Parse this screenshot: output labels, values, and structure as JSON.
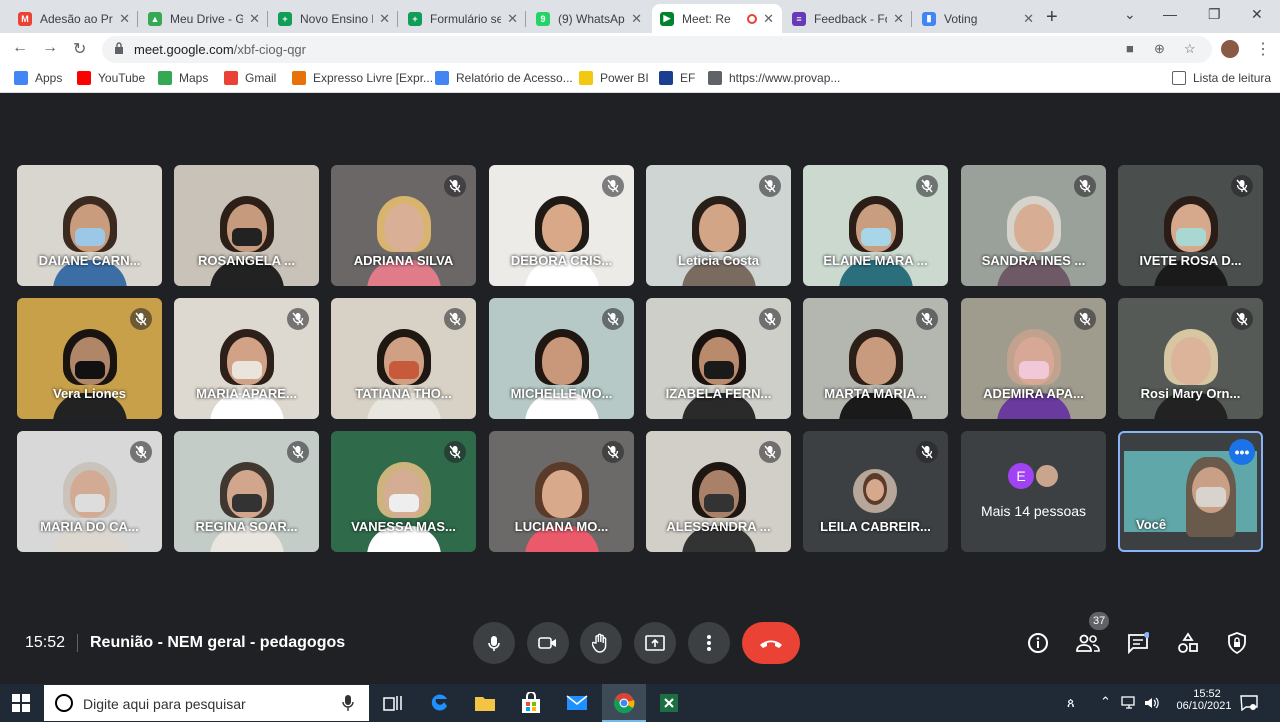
{
  "browser": {
    "tabs": [
      {
        "title": "Adesão ao Pr",
        "color": "#ea4335",
        "glyph": "M"
      },
      {
        "title": "Meu Drive - G",
        "color": "#34a853",
        "glyph": "▲"
      },
      {
        "title": "Novo Ensino M",
        "color": "#0f9d58",
        "glyph": "+"
      },
      {
        "title": "Formulário se",
        "color": "#0f9d58",
        "glyph": "+"
      },
      {
        "title": "(9) WhatsApp",
        "color": "#25d366",
        "glyph": "9"
      },
      {
        "title": "Meet: Re",
        "color": "#00832d",
        "glyph": "▶",
        "active": true
      },
      {
        "title": "Feedback - Fo",
        "color": "#673ab7",
        "glyph": "≡"
      },
      {
        "title": "Voting",
        "color": "#4285f4",
        "glyph": "▮"
      }
    ],
    "url_host": "meet.google.com",
    "url_path": "/xbf-ciog-qgr",
    "bookmarks": [
      {
        "label": "Apps",
        "color": "#4285f4"
      },
      {
        "label": "YouTube",
        "color": "#ff0000"
      },
      {
        "label": "Maps",
        "color": "#34a853"
      },
      {
        "label": "Gmail",
        "color": "#ea4335"
      },
      {
        "label": "Expresso Livre [Expr...",
        "color": "#e8710a"
      },
      {
        "label": "Relatório de Acesso...",
        "color": "#4285f4"
      },
      {
        "label": "Power BI",
        "color": "#f2c811"
      },
      {
        "label": "EF",
        "color": "#1a3f91"
      },
      {
        "label": "https://www.provap...",
        "color": "#5f6368"
      }
    ],
    "reading_list": "Lista de leitura"
  },
  "meeting": {
    "participants": [
      "DAIANE CARN...",
      "ROSANGELA ...",
      "ADRIANA SILVA",
      "DEBORA CRIS...",
      "Leticia Costa",
      "ELAINE MARA ...",
      "SANDRA INES ...",
      "IVETE ROSA D...",
      "Vera Liones",
      "MARIA APARE...",
      "TATIANA THO...",
      "MICHELLE MO...",
      "IZABELA FERN...",
      "MARTA MARIA...",
      "ADEMIRA APA...",
      "Rosi Mary Orn...",
      "MARIA DO CA...",
      "REGINA SOAR...",
      "VANESSA MAS...",
      "LUCIANA MO...",
      "ALESSANDRA ...",
      "LEILA CABREIR..."
    ],
    "more_people": "Mais 14 pessoas",
    "more_initial": "E",
    "self_label": "Você",
    "time": "15:52",
    "title": "Reunião - NEM geral - pedagogos",
    "participant_count": "37"
  },
  "taskbar": {
    "search_placeholder": "Digite aqui para pesquisar",
    "clock_time": "15:52",
    "clock_date": "06/10/2021"
  }
}
